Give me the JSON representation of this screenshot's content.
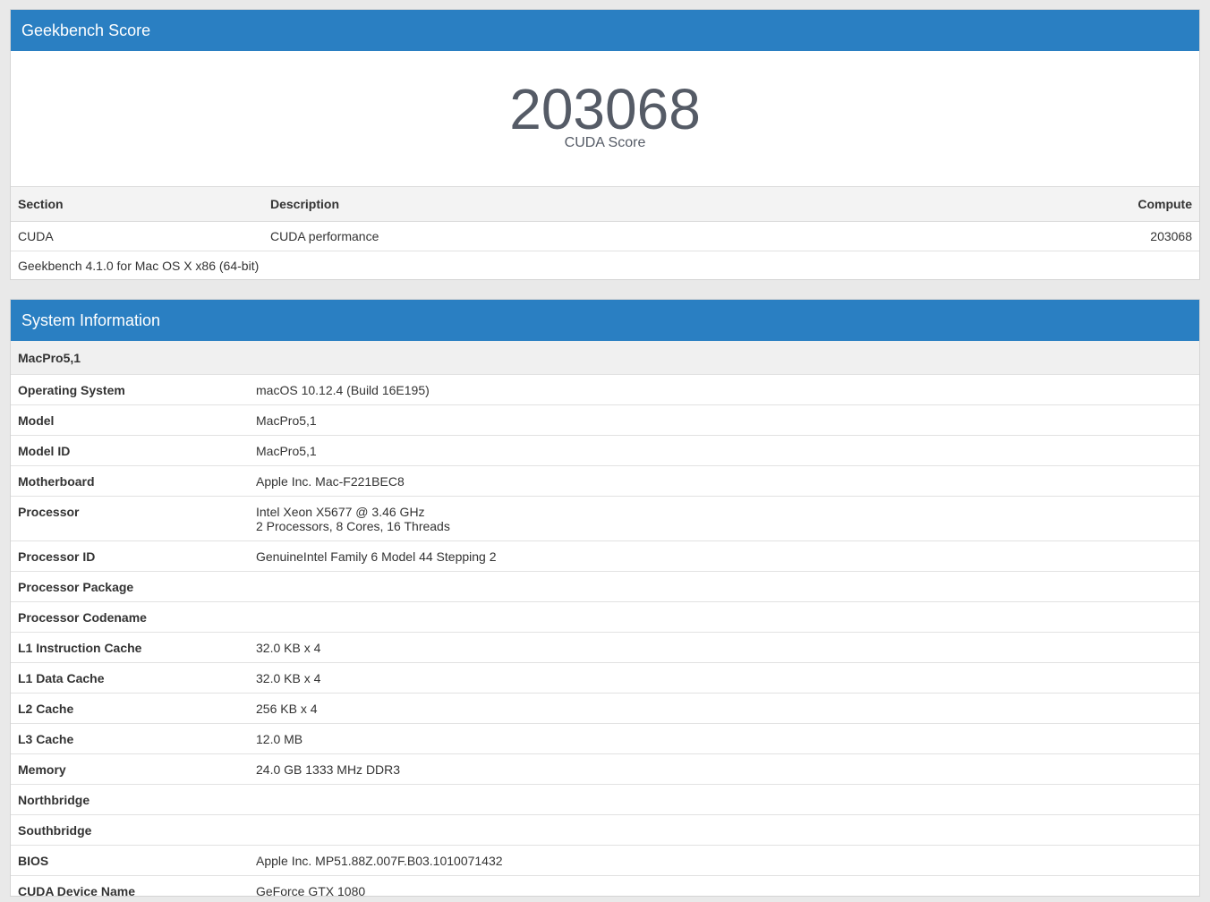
{
  "score_panel": {
    "title": "Geekbench Score",
    "score": "203068",
    "score_label": "CUDA Score",
    "table": {
      "headers": [
        "Section",
        "Description",
        "Compute"
      ],
      "rows": [
        {
          "section": "CUDA",
          "description": "CUDA performance",
          "compute": "203068"
        }
      ]
    },
    "version": "Geekbench 4.1.0 for Mac OS X x86 (64-bit)"
  },
  "system_panel": {
    "title": "System Information",
    "group": "MacPro5,1",
    "rows": [
      {
        "key": "Operating System",
        "value": "macOS 10.12.4 (Build 16E195)"
      },
      {
        "key": "Model",
        "value": "MacPro5,1"
      },
      {
        "key": "Model ID",
        "value": "MacPro5,1"
      },
      {
        "key": "Motherboard",
        "value": "Apple Inc. Mac-F221BEC8"
      },
      {
        "key": "Processor",
        "value": "Intel Xeon X5677 @ 3.46 GHz",
        "value2": "2 Processors, 8 Cores, 16 Threads"
      },
      {
        "key": "Processor ID",
        "value": "GenuineIntel Family 6 Model 44 Stepping 2"
      },
      {
        "key": "Processor Package",
        "value": ""
      },
      {
        "key": "Processor Codename",
        "value": ""
      },
      {
        "key": "L1 Instruction Cache",
        "value": "32.0 KB x 4"
      },
      {
        "key": "L1 Data Cache",
        "value": "32.0 KB x 4"
      },
      {
        "key": "L2 Cache",
        "value": "256 KB x 4"
      },
      {
        "key": "L3 Cache",
        "value": "12.0 MB"
      },
      {
        "key": "Memory",
        "value": "24.0 GB 1333 MHz DDR3"
      },
      {
        "key": "Northbridge",
        "value": ""
      },
      {
        "key": "Southbridge",
        "value": ""
      },
      {
        "key": "BIOS",
        "value": "Apple Inc. MP51.88Z.007F.B03.1010071432"
      },
      {
        "key": "CUDA Device Name",
        "value": "GeForce GTX 1080"
      }
    ]
  },
  "colors": {
    "header_blue": "#2a7fc2",
    "score_text": "#555b66",
    "page_background": "#e9e9e9"
  }
}
